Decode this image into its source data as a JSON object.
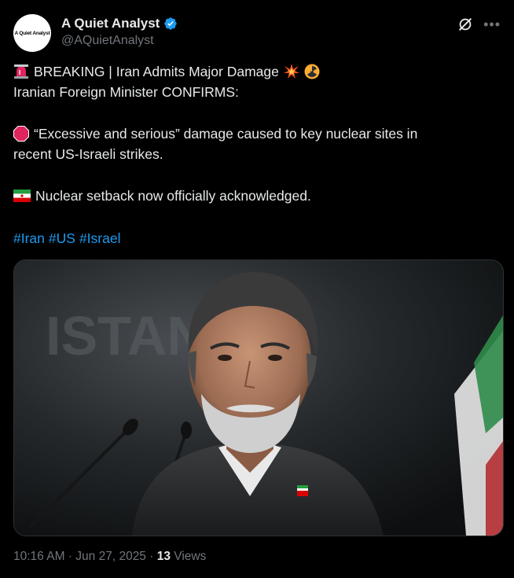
{
  "author": {
    "display_name": "A Quiet Analyst",
    "handle": "@AQuietAnalyst",
    "avatar_text": "A Quiet Analyst",
    "verified": true
  },
  "post": {
    "line1_text": "BREAKING | Iran Admits Major Damage",
    "line2_text": "Iranian Foreign Minister CONFIRMS:",
    "line3_text": "“Excessive and serious” damage caused to key nuclear sites in",
    "line4_text": "recent US-Israeli strikes.",
    "line5_text": "Nuclear setback now officially acknowledged.",
    "hashtags": [
      "#Iran",
      "#US",
      "#Israel"
    ]
  },
  "media": {
    "image_text": "ISTAN"
  },
  "footer": {
    "time": "10:16 AM",
    "separator1": "·",
    "date": "Jun 27, 2025",
    "separator2": "·",
    "views_count": "13",
    "views_label": "Views"
  },
  "icons": {
    "verified": "verified-badge-icon",
    "grok": "grok-icon",
    "more": "more-options-icon",
    "siren": "siren-emoji",
    "collision": "collision-emoji",
    "radioactive": "radioactive-emoji",
    "stop": "stop-sign-emoji",
    "flag": "iran-flag-emoji"
  },
  "colors": {
    "background": "#000000",
    "text": "#e7e9ea",
    "secondary": "#71767b",
    "link": "#1d9bf0",
    "verified": "#1d9bf0"
  }
}
